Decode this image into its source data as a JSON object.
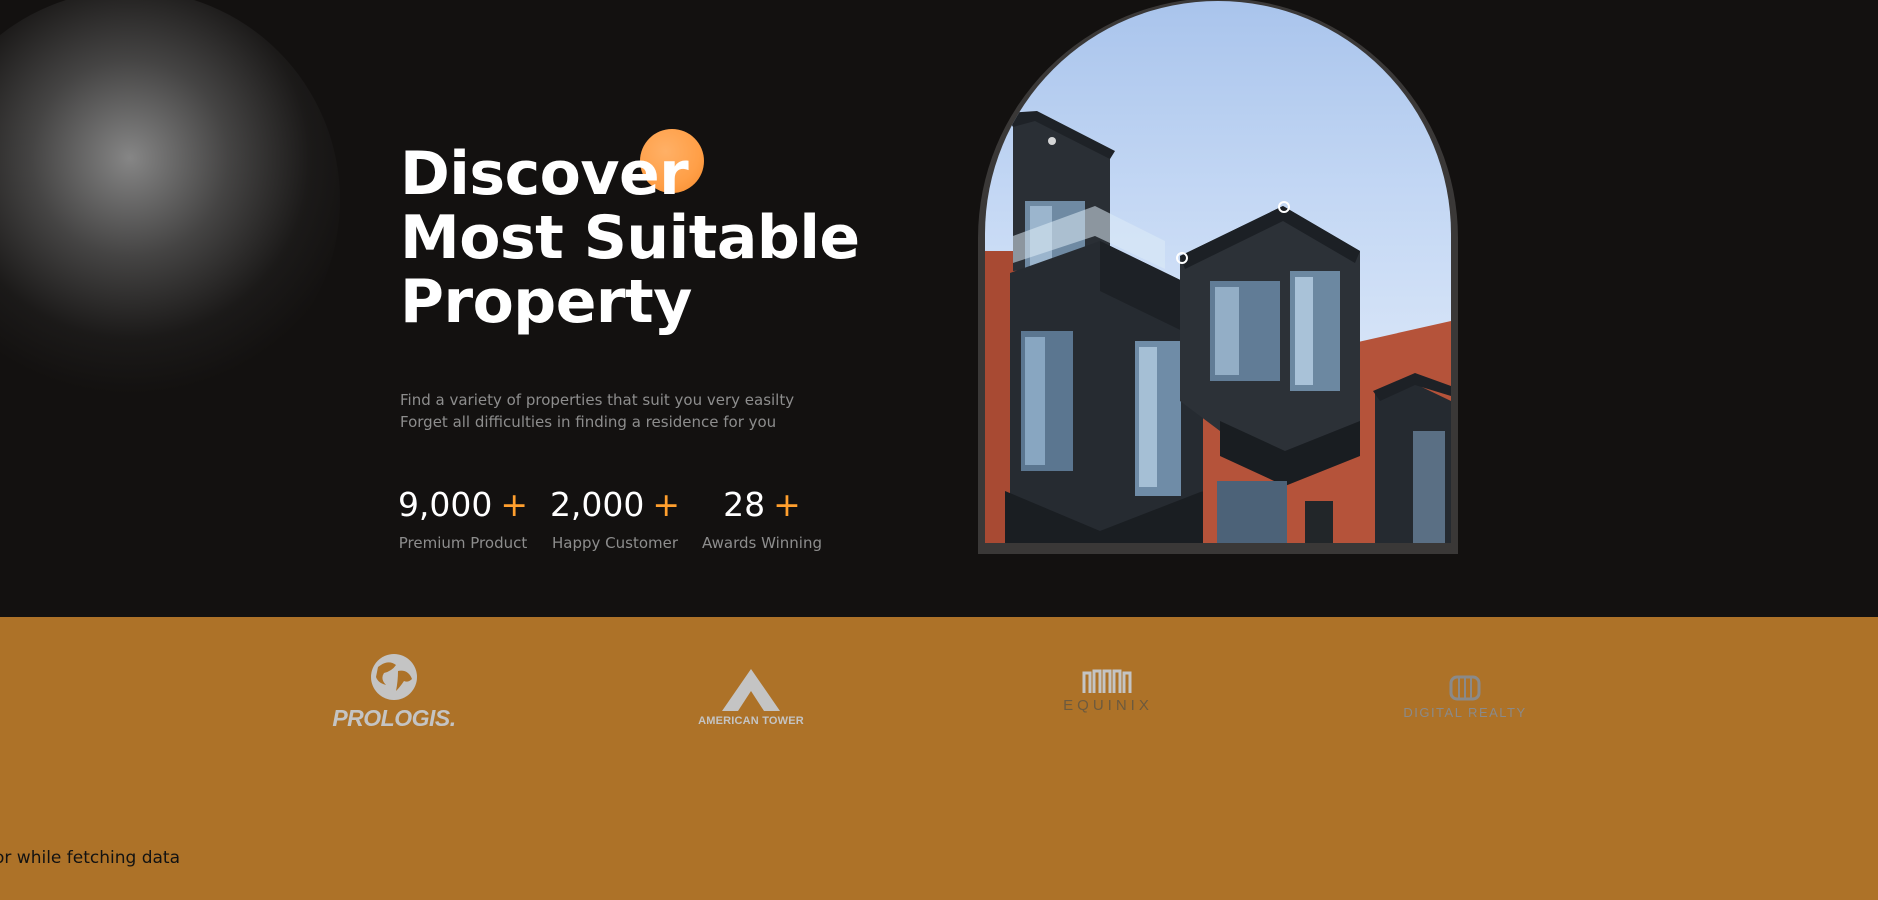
{
  "hero": {
    "title_line1": "Discover",
    "title_line2": "Most Suitable",
    "title_line3": "Property",
    "subtitle_line1": "Find a variety of properties that suit you very easilty",
    "subtitle_line2": "Forget all difficulties in finding a residence for you",
    "stats": [
      {
        "number": "9,000",
        "plus": "+",
        "label": "Premium Product"
      },
      {
        "number": "2,000",
        "plus": "+",
        "label": "Happy Customer"
      },
      {
        "number": "28",
        "plus": "+",
        "label": "Awards Winning"
      }
    ]
  },
  "partners": {
    "prologis": "PROLOGIS.",
    "american_tower": "AMERICAN TOWER",
    "equinix": "EQUINIX",
    "digital_realty": "DIGITAL REALTY"
  },
  "status": {
    "error_message": "or while fetching data"
  },
  "colors": {
    "background": "#131110",
    "accent_orange": "#ff9f2e",
    "logo_band": "#ad7228"
  }
}
